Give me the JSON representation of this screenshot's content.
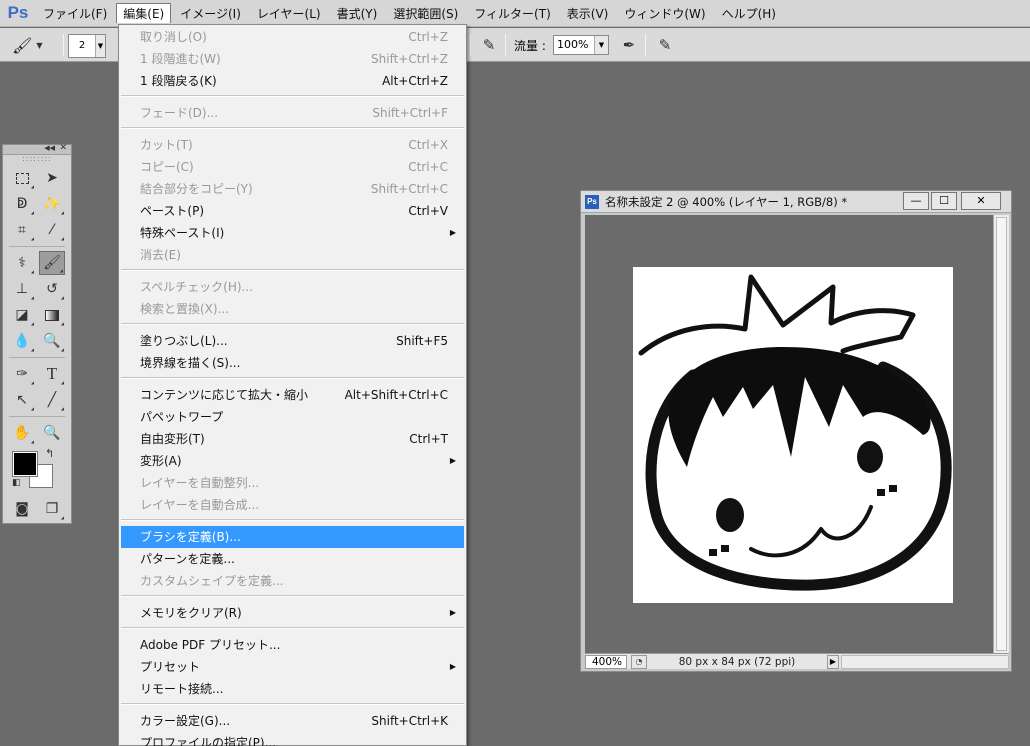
{
  "app": {
    "logo": "Ps"
  },
  "menubar": [
    "ファイル(F)",
    "編集(E)",
    "イメージ(I)",
    "レイヤー(L)",
    "書式(Y)",
    "選択範囲(S)",
    "フィルター(T)",
    "表示(V)",
    "ウィンドウ(W)",
    "ヘルプ(H)"
  ],
  "options": {
    "brush_size": "2",
    "flow_label": "流量 :",
    "flow_value": "100%"
  },
  "edit_menu": {
    "items": [
      {
        "label": "取り消し(O)",
        "shortcut": "Ctrl+Z",
        "disabled": true
      },
      {
        "label": "1 段階進む(W)",
        "shortcut": "Shift+Ctrl+Z",
        "disabled": true
      },
      {
        "label": "1 段階戻る(K)",
        "shortcut": "Alt+Ctrl+Z",
        "disabled": false
      },
      {
        "label": "フェード(D)...",
        "shortcut": "Shift+Ctrl+F",
        "disabled": true
      },
      {
        "label": "カット(T)",
        "shortcut": "Ctrl+X",
        "disabled": true
      },
      {
        "label": "コピー(C)",
        "shortcut": "Ctrl+C",
        "disabled": true
      },
      {
        "label": "結合部分をコピー(Y)",
        "shortcut": "Shift+Ctrl+C",
        "disabled": true
      },
      {
        "label": "ペースト(P)",
        "shortcut": "Ctrl+V",
        "disabled": false
      },
      {
        "label": "特殊ペースト(I)",
        "shortcut": "",
        "disabled": false,
        "submenu": true
      },
      {
        "label": "消去(E)",
        "shortcut": "",
        "disabled": true
      },
      {
        "label": "スペルチェック(H)...",
        "shortcut": "",
        "disabled": true
      },
      {
        "label": "検索と置換(X)...",
        "shortcut": "",
        "disabled": true
      },
      {
        "label": "塗りつぶし(L)...",
        "shortcut": "Shift+F5",
        "disabled": false
      },
      {
        "label": "境界線を描く(S)...",
        "shortcut": "",
        "disabled": false
      },
      {
        "label": "コンテンツに応じて拡大・縮小",
        "shortcut": "Alt+Shift+Ctrl+C",
        "disabled": false
      },
      {
        "label": "パペットワープ",
        "shortcut": "",
        "disabled": false
      },
      {
        "label": "自由変形(T)",
        "shortcut": "Ctrl+T",
        "disabled": false
      },
      {
        "label": "変形(A)",
        "shortcut": "",
        "disabled": false,
        "submenu": true
      },
      {
        "label": "レイヤーを自動整列...",
        "shortcut": "",
        "disabled": true
      },
      {
        "label": "レイヤーを自動合成...",
        "shortcut": "",
        "disabled": true
      },
      {
        "label": "ブラシを定義(B)...",
        "shortcut": "",
        "disabled": false,
        "highlighted": true
      },
      {
        "label": "パターンを定義...",
        "shortcut": "",
        "disabled": false
      },
      {
        "label": "カスタムシェイプを定義...",
        "shortcut": "",
        "disabled": true
      },
      {
        "label": "メモリをクリア(R)",
        "shortcut": "",
        "disabled": false,
        "submenu": true
      },
      {
        "label": "Adobe PDF プリセット...",
        "shortcut": "",
        "disabled": false
      },
      {
        "label": "プリセット",
        "shortcut": "",
        "disabled": false,
        "submenu": true
      },
      {
        "label": "リモート接続...",
        "shortcut": "",
        "disabled": false
      },
      {
        "label": "カラー設定(G)...",
        "shortcut": "Shift+Ctrl+K",
        "disabled": false
      },
      {
        "label": "プロファイルの指定(P)...",
        "shortcut": "",
        "disabled": false
      }
    ]
  },
  "document": {
    "icon_label": "Ps",
    "title": "名称未設定 2 @ 400% (レイヤー 1, RGB/8) *",
    "zoom": "400%",
    "dims": "80 px x 84 px (72 ppi)"
  },
  "colors": {
    "foreground": "#000000",
    "background": "#ffffff",
    "menu_highlight": "#3399ff"
  },
  "icons": {
    "tools": [
      "marquee-icon",
      "move-icon",
      "lasso-icon",
      "magic-wand-icon",
      "crop-icon",
      "eyedropper-icon",
      "healing-brush-icon",
      "brush-icon",
      "clone-stamp-icon",
      "history-brush-icon",
      "eraser-icon",
      "gradient-icon",
      "blur-icon",
      "dodge-icon",
      "pen-icon",
      "type-icon",
      "path-selection-icon",
      "line-icon",
      "hand-icon",
      "zoom-icon",
      "quick-mask-icon",
      "screen-mode-icon"
    ]
  }
}
